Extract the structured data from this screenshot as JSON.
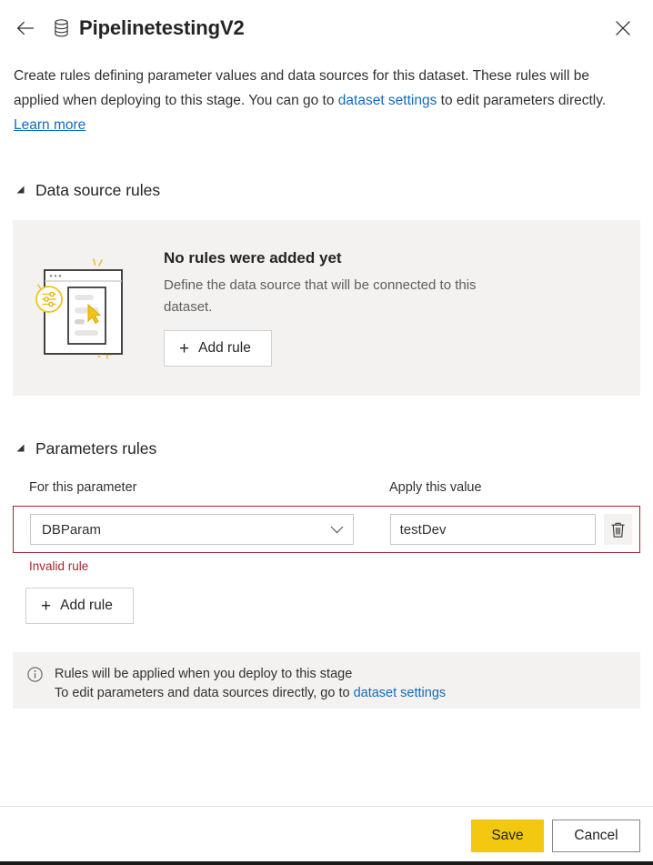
{
  "header": {
    "back_icon": "back-arrow-icon",
    "dataset_icon": "database-icon",
    "title": "PipelinetestingV2",
    "close_icon": "close-icon"
  },
  "description": {
    "part1": "Create rules defining parameter values and data sources for this dataset. These rules will be applied when deploying to this stage. You can go to ",
    "link1": "dataset settings",
    "part2": " to edit parameters directly.  ",
    "link2": "Learn more"
  },
  "data_source_section": {
    "caret_icon": "caret-expanded-icon",
    "title": "Data source rules",
    "empty_state": {
      "illustration": "no-rules-illustration",
      "title": "No rules were added yet",
      "subtitle": "Define the data source that will be connected to this dataset.",
      "add_rule_label": "Add rule",
      "add_icon": "plus-icon"
    }
  },
  "parameters_section": {
    "caret_icon": "caret-expanded-icon",
    "title": "Parameters rules",
    "columns": {
      "parameter": "For this parameter",
      "value": "Apply this value"
    },
    "rules": [
      {
        "parameter": "DBParam",
        "parameter_dropdown_icon": "chevron-down-icon",
        "value": "testDev",
        "value_placeholder": "",
        "delete_icon": "trash-icon",
        "error": "Invalid rule"
      }
    ],
    "add_rule_label": "Add rule",
    "add_icon": "plus-icon"
  },
  "info_banner": {
    "icon": "info-circle-icon",
    "line1": "Rules will be applied when you deploy to this stage",
    "line2_prefix": "To edit parameters and data sources directly, go to ",
    "line2_link": "dataset settings"
  },
  "footer": {
    "save_label": "Save",
    "cancel_label": "Cancel"
  },
  "colors": {
    "accent_yellow": "#f2c811",
    "link_blue": "#0f6cbd",
    "error_red": "#a4262c",
    "panel_grey": "#f3f2f1"
  }
}
